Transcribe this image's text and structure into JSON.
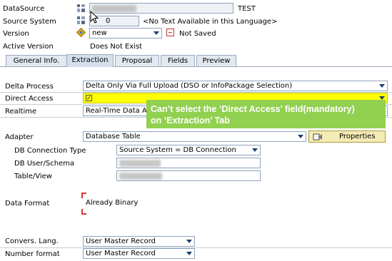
{
  "header": {
    "datasource_label": "DataSource",
    "datasource_suffix": "TEST",
    "source_system_label": "Source System",
    "source_system_value": "0",
    "source_system_text": "<No Text Available in this Language>",
    "version_label": "Version",
    "version_value": "new",
    "version_status": "Not Saved",
    "active_version_label": "Active Version",
    "active_version_value": "Does Not Exist"
  },
  "tabs": [
    {
      "label": "General Info."
    },
    {
      "label": "Extraction"
    },
    {
      "label": "Proposal"
    },
    {
      "label": "Fields"
    },
    {
      "label": "Preview"
    }
  ],
  "extraction": {
    "delta_process_label": "Delta Process",
    "delta_process_value": "Delta Only Via Full Upload (DSO or InfoPackage Selection)",
    "direct_access_label": "Direct Access",
    "realtime_label": "Realtime",
    "realtime_value": "Real-Time Data Acqu",
    "adapter_label": "Adapter",
    "adapter_value": "Database Table",
    "properties_label": "Properties",
    "db_connection_type_label": "DB Connection Type",
    "db_connection_type_value": "Source System = DB Connection",
    "db_user_schema_label": "DB User/Schema",
    "table_view_label": "Table/View",
    "data_format_label": "Data Format",
    "data_format_value": "Already Binary",
    "convers_lang_label": "Convers. Lang.",
    "convers_lang_value": "User Master Record",
    "number_format_label": "Number format",
    "number_format_value": "User Master Record"
  },
  "annotation": {
    "line1": "Can’t select the ‘Direct Access’ field(mandatory)",
    "line2": "on ‘Extraction’ Tab"
  },
  "colors": {
    "highlight": "#ffff00",
    "annotation_bg": "#92d050"
  }
}
